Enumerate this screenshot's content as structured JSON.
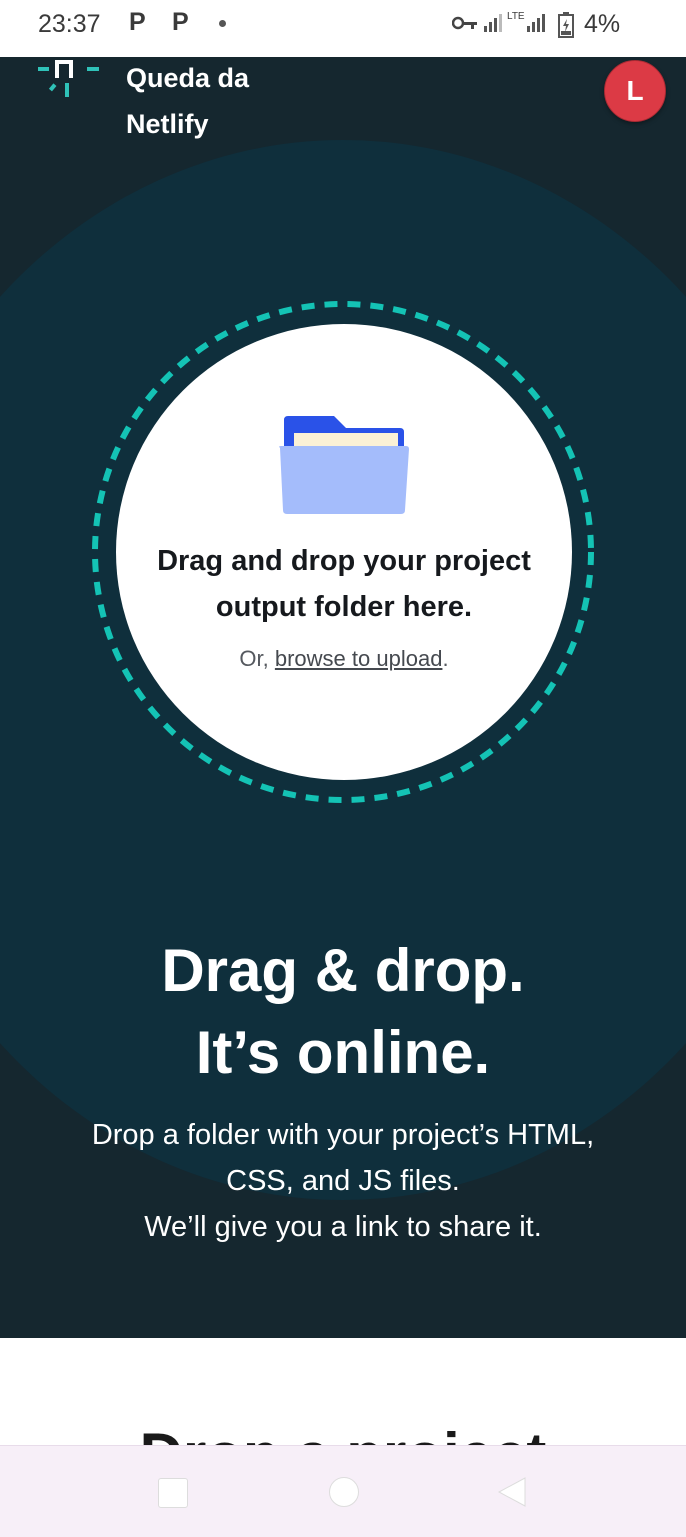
{
  "status_bar": {
    "time": "23:37",
    "notification_icons": [
      "P",
      "P"
    ],
    "battery": "4%",
    "network_label": "LTE"
  },
  "header": {
    "site_name": "Queda da Netlify",
    "avatar_initial": "L",
    "avatar_color": "#dc3a45"
  },
  "dropzone": {
    "title": "Drag and drop your project output folder here.",
    "or_text": "Or, ",
    "browse_link": "browse to upload",
    "period": "."
  },
  "hero": {
    "headline_line1": "Drag & drop.",
    "headline_line2": "It’s online.",
    "desc_line1": "Drop a folder with your project’s HTML,",
    "desc_line2": "CSS, and JS files.",
    "desc_line3": "We’ll give you a link to share it."
  },
  "next_section": {
    "heading_partial": "Drop a project"
  },
  "colors": {
    "hero_bg": "#15272f",
    "halo": "#0f2f3c",
    "accent_teal": "#14c3b5",
    "folder_blue": "#2a52e8"
  }
}
